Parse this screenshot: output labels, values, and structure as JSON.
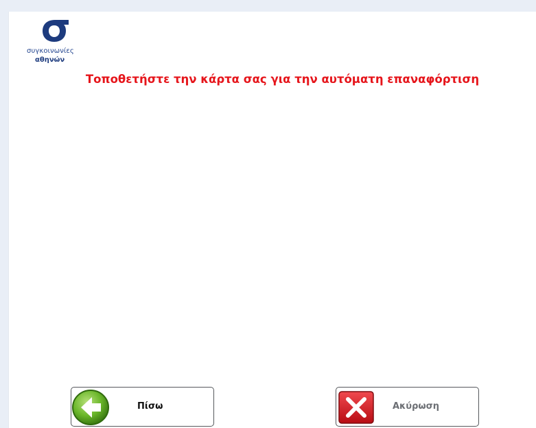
{
  "logo": {
    "line1": "συγκοινωνίες",
    "line2": "αθηνών",
    "icon": "sigma-logo-icon",
    "color": "#1d3b7e"
  },
  "main": {
    "instruction": "Τοποθετήστε την κάρτα σας για την αυτόματη επαναφόρτιση",
    "instruction_color": "#e6151b"
  },
  "buttons": {
    "back": {
      "label": "Πίσω",
      "icon": "back-arrow-icon",
      "icon_color": "#6ab72a"
    },
    "cancel": {
      "label": "Ακύρωση",
      "icon": "close-x-icon",
      "icon_color": "#d8141c"
    }
  }
}
